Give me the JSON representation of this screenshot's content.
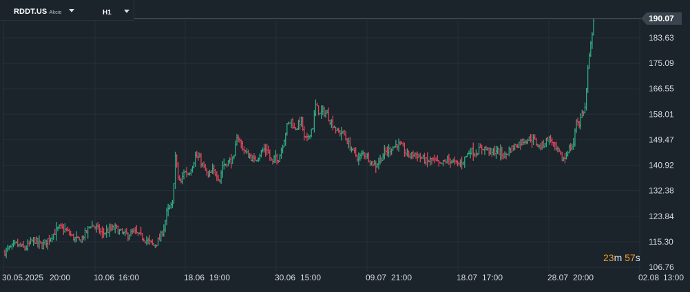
{
  "toolbar": {
    "symbol": "RDDT.US",
    "symbol_type": "Akcie",
    "timeframe": "H1"
  },
  "countdown": {
    "minutes": "23",
    "m": "m",
    "seconds": "57",
    "s": "s"
  },
  "colors": {
    "background": "#1b232b",
    "grid": "#26303a",
    "up": "#2fae85",
    "down": "#e0475b",
    "axis_text": "#d5dbe1",
    "price_tag": "#3a444e",
    "countdown": "#f29b2b"
  },
  "chart_data": {
    "type": "ohlc",
    "title": "",
    "timeframe": "H1",
    "current_price": "190.07",
    "price_line": 190.07,
    "ylim": [
      106.76,
      190.07
    ],
    "y_ticks": [
      "190.07",
      "183.63",
      "175.09",
      "166.55",
      "158.01",
      "149.47",
      "140.92",
      "132.38",
      "123.84",
      "115.30",
      "106.76"
    ],
    "x_ticks": [
      "30.05.2025",
      "20:00",
      "10.06",
      "16:00",
      "18.06",
      "19:00",
      "30.06",
      "15:00",
      "09.07",
      "21:00",
      "18.07",
      "17:00",
      "28.07",
      "20:00",
      "02.08",
      "13:00"
    ],
    "grid": true,
    "close_path": [
      [
        0,
        112
      ],
      [
        8,
        114.5
      ],
      [
        14,
        113
      ],
      [
        20,
        116
      ],
      [
        26,
        114
      ],
      [
        32,
        117
      ],
      [
        38,
        120
      ],
      [
        43,
        119
      ],
      [
        47,
        117
      ],
      [
        52,
        115.5
      ],
      [
        56,
        118
      ],
      [
        60,
        121
      ],
      [
        64,
        120
      ],
      [
        68,
        118
      ],
      [
        72,
        119
      ],
      [
        77,
        120
      ],
      [
        82,
        118
      ],
      [
        86,
        117.5
      ],
      [
        90,
        118.5
      ],
      [
        95,
        117
      ],
      [
        100,
        115.5
      ],
      [
        104,
        114
      ],
      [
        108,
        116
      ],
      [
        111,
        120
      ],
      [
        113,
        125
      ],
      [
        115,
        126.5
      ],
      [
        117,
        127.5
      ],
      [
        119,
        144
      ],
      [
        121,
        137
      ],
      [
        123,
        135
      ],
      [
        125,
        139
      ],
      [
        128,
        138
      ],
      [
        131,
        141
      ],
      [
        133,
        144
      ],
      [
        136,
        143
      ],
      [
        139,
        140
      ],
      [
        142,
        137
      ],
      [
        145,
        139
      ],
      [
        148,
        138
      ],
      [
        150,
        136
      ],
      [
        152,
        141
      ],
      [
        156,
        142
      ],
      [
        160,
        143
      ],
      [
        162,
        151
      ],
      [
        165,
        148
      ],
      [
        168,
        145
      ],
      [
        171,
        144
      ],
      [
        174,
        142.5
      ],
      [
        177,
        144
      ],
      [
        180,
        146
      ],
      [
        183,
        146.5
      ],
      [
        185,
        143.5
      ],
      [
        187,
        141.5
      ],
      [
        189,
        144
      ],
      [
        191,
        143
      ],
      [
        193,
        146
      ],
      [
        195,
        150
      ],
      [
        197,
        154
      ],
      [
        200,
        156
      ],
      [
        202,
        153
      ],
      [
        204,
        154
      ],
      [
        207,
        156
      ],
      [
        209,
        150
      ],
      [
        211,
        149.5
      ],
      [
        213,
        152
      ],
      [
        215,
        154
      ],
      [
        217,
        161
      ],
      [
        220,
        158
      ],
      [
        222,
        159
      ],
      [
        225,
        158
      ],
      [
        227,
        156
      ],
      [
        230,
        154
      ],
      [
        232,
        152
      ],
      [
        235,
        152
      ],
      [
        237,
        151
      ],
      [
        239,
        149
      ],
      [
        241,
        147
      ],
      [
        244,
        145
      ],
      [
        247,
        143
      ],
      [
        250,
        145
      ],
      [
        253,
        144
      ],
      [
        256,
        142
      ],
      [
        259,
        141
      ],
      [
        262,
        143
      ],
      [
        265,
        145
      ],
      [
        268,
        146
      ],
      [
        271,
        147
      ],
      [
        274,
        148
      ],
      [
        277,
        147
      ],
      [
        280,
        145
      ],
      [
        283,
        144
      ],
      [
        286,
        145
      ],
      [
        289,
        144
      ],
      [
        292,
        143
      ],
      [
        295,
        142
      ],
      [
        298,
        143
      ],
      [
        301,
        142
      ],
      [
        304,
        141
      ],
      [
        307,
        142
      ],
      [
        310,
        143
      ],
      [
        313,
        142
      ],
      [
        316,
        141
      ],
      [
        319,
        142
      ],
      [
        322,
        144
      ],
      [
        325,
        146
      ],
      [
        328,
        145
      ],
      [
        331,
        146
      ],
      [
        334,
        147
      ],
      [
        337,
        146
      ],
      [
        340,
        145
      ],
      [
        343,
        146
      ],
      [
        346,
        145
      ],
      [
        349,
        144
      ],
      [
        352,
        146
      ],
      [
        355,
        147
      ],
      [
        358,
        148
      ],
      [
        361,
        149
      ],
      [
        364,
        149.5
      ],
      [
        367,
        150
      ],
      [
        370,
        149
      ],
      [
        373,
        147
      ],
      [
        376,
        148
      ],
      [
        379,
        150
      ],
      [
        382,
        149
      ],
      [
        385,
        146
      ],
      [
        387,
        145
      ],
      [
        389,
        143
      ],
      [
        391,
        143.5
      ],
      [
        393,
        146
      ],
      [
        395,
        147
      ],
      [
        397,
        148
      ],
      [
        399,
        156
      ],
      [
        401,
        155
      ],
      [
        403,
        158.5
      ],
      [
        405,
        160
      ],
      [
        407,
        173
      ],
      [
        409,
        181
      ],
      [
        411,
        190
      ]
    ]
  }
}
